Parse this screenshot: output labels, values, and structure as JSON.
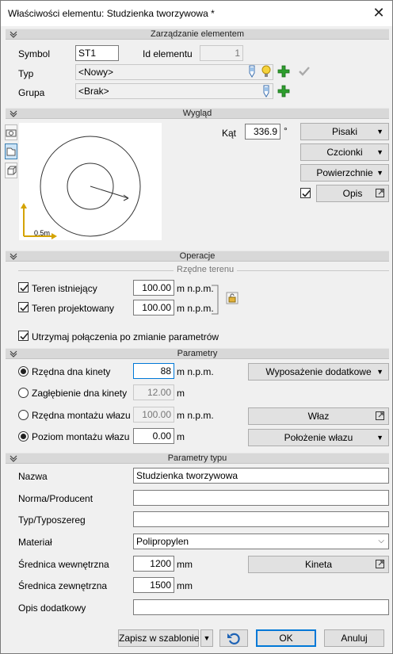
{
  "window": {
    "title": "Właściwości elementu: Studzienka tworzywowa *"
  },
  "sections": {
    "zarzadzanie": "Zarządzanie elementem",
    "wyglad": "Wygląd",
    "operacje": "Operacje",
    "parametry": "Parametry",
    "parametry_typu": "Parametry typu"
  },
  "element": {
    "symbol_label": "Symbol",
    "symbol_value": "ST1",
    "id_label": "Id elementu",
    "id_value": "1",
    "typ_label": "Typ",
    "typ_value": "<Nowy>",
    "grupa_label": "Grupa",
    "grupa_value": "<Brak>"
  },
  "wyglad": {
    "kat_label": "Kąt",
    "kat_value": "336.9",
    "kat_unit": "°",
    "scale_label": "0.5m",
    "buttons": {
      "pisaki": "Pisaki",
      "czcionki": "Czcionki",
      "powierzchnie": "Powierzchnie",
      "opis": "Opis"
    },
    "opis_checked": true
  },
  "operacje": {
    "rzedne_terenu": "Rzędne terenu",
    "teren_istniejacy_label": "Teren istniejący",
    "teren_istniejacy_value": "100.00",
    "teren_projektowany_label": "Teren projektowany",
    "teren_projektowany_value": "100.00",
    "unit": "m n.p.m.",
    "utrzymaj_label": "Utrzymaj połączenia po zmianie parametrów"
  },
  "parametry": {
    "rzedna_dna_label": "Rzędna dna kinety",
    "rzedna_dna_value": "88",
    "rzedna_dna_unit": "m n.p.m.",
    "zaglebienie_label": "Zagłębienie dna kinety",
    "zaglebienie_value": "12.00",
    "zaglebienie_unit": "m",
    "rzedna_montazu_label": "Rzędna montażu włazu",
    "rzedna_montazu_value": "100.00",
    "rzedna_montazu_unit": "m n.p.m.",
    "poziom_montazu_label": "Poziom montażu włazu",
    "poziom_montazu_value": "0.00",
    "poziom_montazu_unit": "m",
    "wyposazenie": "Wyposażenie dodatkowe",
    "wlaz": "Właz",
    "polozenie": "Położenie włazu"
  },
  "parametry_typu": {
    "nazwa_label": "Nazwa",
    "nazwa_value": "Studzienka tworzywowa",
    "norma_label": "Norma/Producent",
    "norma_value": "",
    "typ_label": "Typ/Typoszereg",
    "typ_value": "",
    "material_label": "Materiał",
    "material_value": "Polipropylen",
    "sr_wew_label": "Średnica wewnętrzna",
    "sr_wew_value": "1200",
    "sr_zew_label": "Średnica zewnętrzna",
    "sr_zew_value": "1500",
    "unit_mm": "mm",
    "kineta": "Kineta",
    "opis_dod_label": "Opis dodatkowy",
    "opis_dod_value": ""
  },
  "footer": {
    "zapisz": "Zapisz w szablonie",
    "ok": "OK",
    "anuluj": "Anuluj"
  }
}
